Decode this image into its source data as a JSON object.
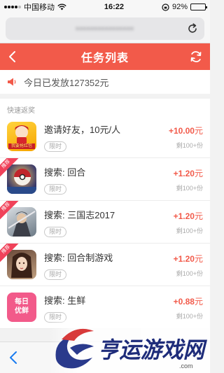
{
  "status_bar": {
    "carrier": "中国移动",
    "time": "16:22",
    "battery_text": "92%",
    "battery_level": 0.92
  },
  "browser": {
    "url": "••••••••••••••••"
  },
  "header": {
    "title": "任务列表"
  },
  "notice": {
    "text": "今日已发放127352元"
  },
  "section": {
    "label": "快速返奖"
  },
  "tasks": [
    {
      "title": "邀请好友，10元/人",
      "tag": "限时",
      "reward": "+10.00",
      "unit": "元",
      "remain": "剩100+份",
      "badge": "",
      "icon": "red-envelope-game-icon"
    },
    {
      "title": "搜索: 回合",
      "tag": "限时",
      "reward": "+1.20",
      "unit": "元",
      "remain": "剩100+份",
      "badge": "推荐",
      "icon": "ball-game-icon"
    },
    {
      "title": "搜索: 三国志2017",
      "tag": "限时",
      "reward": "+1.20",
      "unit": "元",
      "remain": "剩100+份",
      "badge": "推荐",
      "icon": "warrior-game-icon"
    },
    {
      "title": "搜索: 回合制游戏",
      "tag": "限时",
      "reward": "+1.20",
      "unit": "元",
      "remain": "剩100+份",
      "badge": "推荐",
      "icon": "heroine-game-icon"
    },
    {
      "title": "搜索: 生鲜",
      "tag": "限时",
      "reward": "+0.88",
      "unit": "元",
      "remain": "剩100+份",
      "badge": "",
      "icon": "fresh-food-app-icon"
    }
  ],
  "icon_texts": {
    "red_envelope": "我要抢红包",
    "fresh_line1": "每日",
    "fresh_line2": "优鲜"
  },
  "watermark": {
    "text": "亨运游戏网",
    "domain": ".com"
  },
  "colors": {
    "accent": "#f25a4a",
    "badge": "#f0425a"
  }
}
